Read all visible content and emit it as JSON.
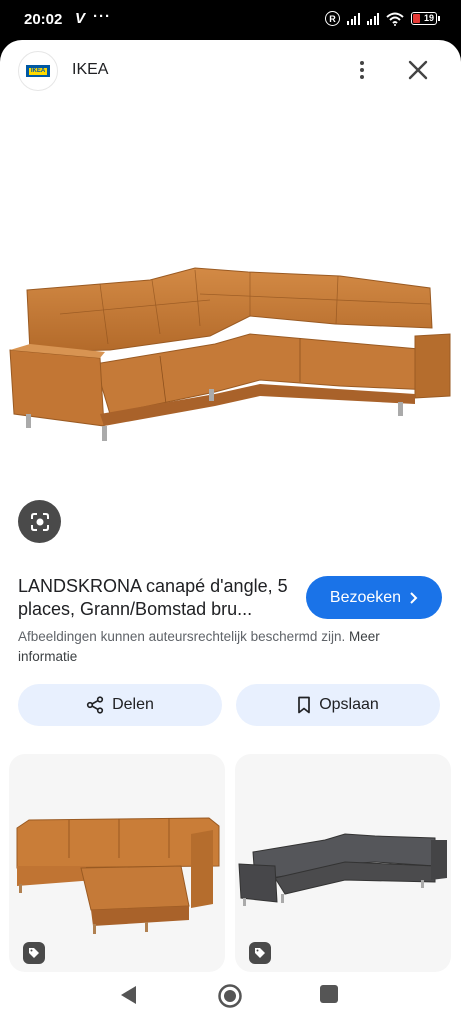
{
  "status_bar": {
    "time": "20:02",
    "carrier_glyph": "V",
    "dots": "···",
    "roaming_badge": "R",
    "battery": "19",
    "icons": [
      "signal-icon",
      "signal-icon",
      "wifi-icon",
      "battery-icon"
    ]
  },
  "header": {
    "logo_text": "IKEA",
    "site_name": "IKEA",
    "icons": [
      "more-vert-icon",
      "close-icon"
    ]
  },
  "hero": {
    "image_subject": "cognac leather corner sofa",
    "icons": [
      "google-lens-icon"
    ]
  },
  "result": {
    "title_bold": "LANDSKRONA",
    "title_rest": " canapé d'angle, 5 places, Grann/Bomstad bru...",
    "visit_label": "Bezoeken",
    "copyright_text": "Afbeeldingen kunnen auteursrechtelijk beschermd zijn. ",
    "more_info_link": "Meer informatie"
  },
  "actions": {
    "share_label": "Delen",
    "save_label": "Opslaan",
    "icons": [
      "share-icon",
      "bookmark-icon"
    ]
  },
  "related": {
    "cards": [
      {
        "subject": "cognac leather sofa with chaise longue",
        "icon": "tag-icon"
      },
      {
        "subject": "dark grey corner sofa",
        "icon": "tag-icon"
      }
    ]
  },
  "nav": {
    "icons": [
      "back-icon",
      "home-icon",
      "recents-icon"
    ]
  },
  "colors": {
    "accent": "#1a73e8",
    "pill_bg": "#e8f0fe",
    "leather": "#c47a35",
    "grey_sofa": "#4b4b4d"
  }
}
